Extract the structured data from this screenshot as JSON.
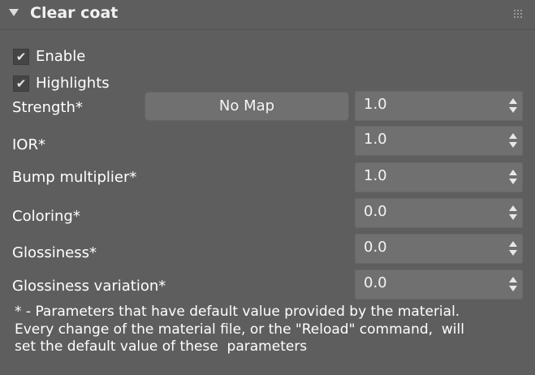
{
  "panel": {
    "title": "Clear coat",
    "collapse_icon": "triangle-down-icon",
    "drag_icon": "grip-dots-icon"
  },
  "options": {
    "enable_label": "Enable",
    "enable_checked": true,
    "highlights_label": "Highlights",
    "highlights_checked": true,
    "check_glyph": "✔"
  },
  "params": {
    "strength_label": "Strength*",
    "strength_map": "No Map",
    "strength_value": "1.0",
    "ior_label": "IOR*",
    "ior_value": "1.0",
    "bump_label": "Bump multiplier*",
    "bump_value": "1.0",
    "coloring_label": "Coloring*",
    "coloring_value": "0.0",
    "glossiness_label": "Glossiness*",
    "glossiness_value": "0.0",
    "gloss_variation_label": "Glossiness variation*",
    "gloss_variation_value": "0.0"
  },
  "footnote": {
    "line1": "* - Parameters that have default value provided by the material.",
    "line2": "Every change of the material file, or the \"Reload\" command,  will",
    "line3": "set the default value of these  parameters"
  },
  "colors": {
    "background": "#5e5e5e",
    "field": "#707070",
    "text": "#ffffff"
  }
}
